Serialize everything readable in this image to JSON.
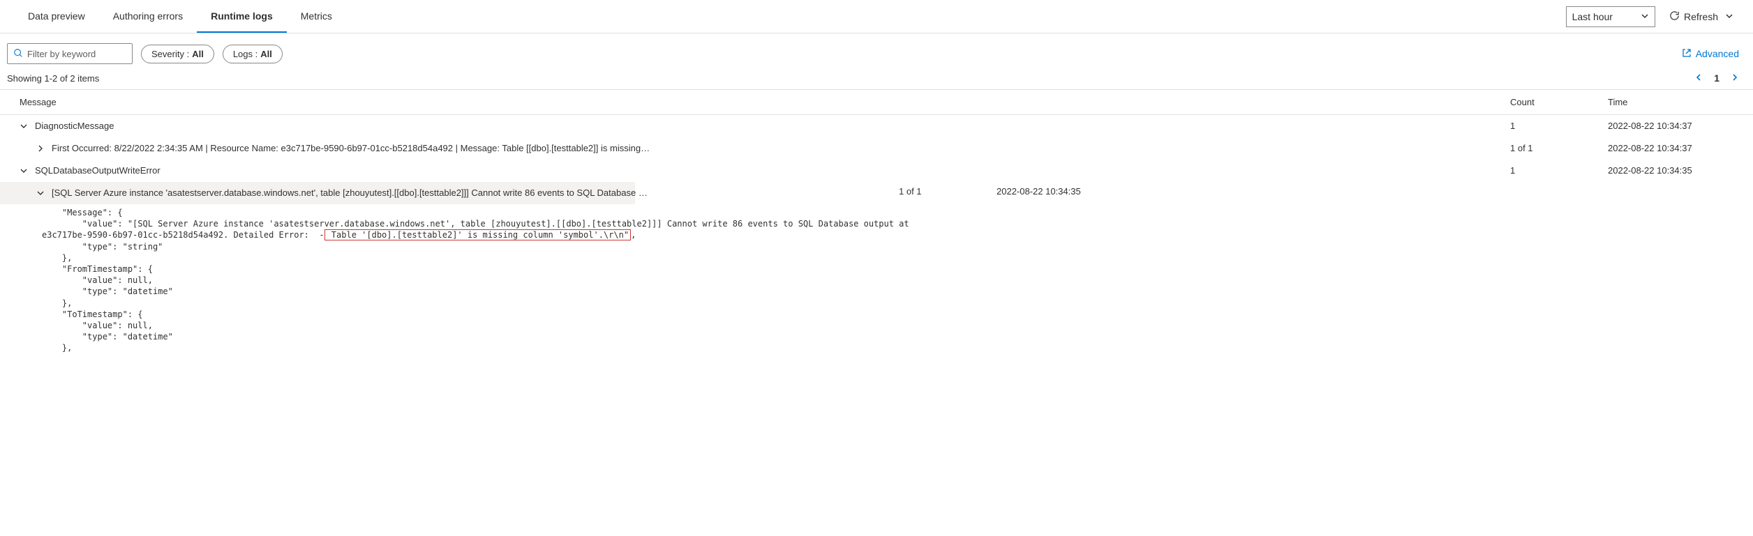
{
  "tabs": {
    "data_preview": "Data preview",
    "authoring_errors": "Authoring errors",
    "runtime_logs": "Runtime logs",
    "metrics": "Metrics"
  },
  "time_range": {
    "selected": "Last hour"
  },
  "refresh_label": "Refresh",
  "filter": {
    "placeholder": "Filter by keyword",
    "severity_label": "Severity :",
    "severity_value": "All",
    "logs_label": "Logs :",
    "logs_value": "All"
  },
  "advanced_label": "Advanced",
  "showing_text": "Showing 1-2 of 2 items",
  "pager": {
    "current": "1"
  },
  "columns": {
    "message": "Message",
    "count": "Count",
    "time": "Time"
  },
  "rows": [
    {
      "message": "DiagnosticMessage",
      "count": "1",
      "time": "2022-08-22 10:34:37",
      "expanded": true,
      "indent": 0
    },
    {
      "message": "First Occurred: 8/22/2022 2:34:35 AM | Resource Name: e3c717be-9590-6b97-01cc-b5218d54a492 | Message: Table [[dbo].[testtable2]] is missing c…",
      "count": "1 of 1",
      "time": "2022-08-22 10:34:37",
      "expanded": false,
      "indent": 1
    },
    {
      "message": "SQLDatabaseOutputWriteError",
      "count": "1",
      "time": "2022-08-22 10:34:35",
      "expanded": true,
      "indent": 0
    },
    {
      "message": "[SQL Server Azure instance 'asatestserver.database.windows.net', table [zhouyutest].[[dbo].[testtable2]]] Cannot write 86 events to SQL Database o…",
      "count": "1 of 1",
      "time": "2022-08-22 10:34:35",
      "expanded": true,
      "indent": 2,
      "highlighted": true
    }
  ],
  "json_detail": {
    "pre_text": "    \"Message\": {\n        \"value\": \"[SQL Server Azure instance 'asatestserver.database.windows.net', table [zhouyutest].[[dbo].[testtable2]]] Cannot write 86 events to SQL Database output at\ne3c717be-9590-6b97-01cc-b5218d54a492. Detailed Error:  -",
    "boxed_text": " Table '[dbo].[testtable2]' is missing column 'symbol'.\\r\\n\"",
    "post_text": ",\n        \"type\": \"string\"\n    },\n    \"FromTimestamp\": {\n        \"value\": null,\n        \"type\": \"datetime\"\n    },\n    \"ToTimestamp\": {\n        \"value\": null,\n        \"type\": \"datetime\"\n    },"
  }
}
